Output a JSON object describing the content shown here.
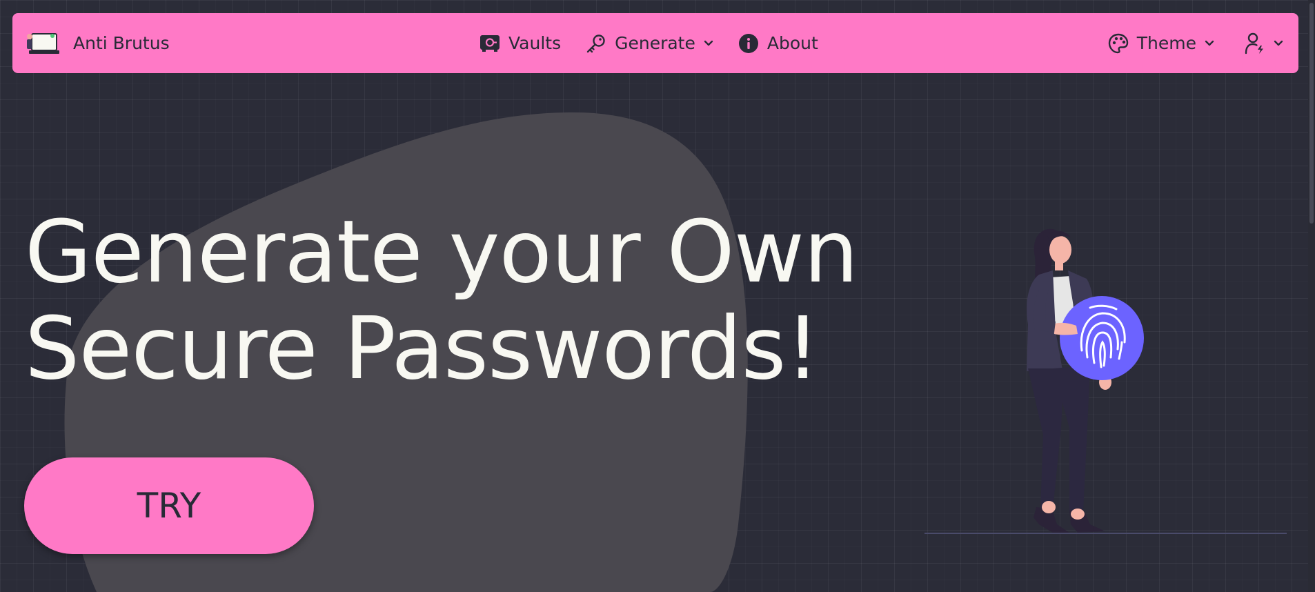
{
  "navbar": {
    "brand_name": "Anti Brutus",
    "brand_logo_icon": "laptop-person-icon",
    "items": [
      {
        "label": "Vaults",
        "icon": "safe-icon"
      },
      {
        "label": "Generate",
        "icon": "key-icon",
        "dropdown": true
      },
      {
        "label": "About",
        "icon": "info-circle-icon"
      }
    ],
    "theme_label": "Theme",
    "theme_icon": "palette-icon",
    "user_icon": "user-bolt-icon",
    "background_color": "#ff79c6"
  },
  "hero": {
    "headline_line1": "Generate your Own",
    "headline_line2": "Secure Passwords!",
    "try_label": "TRY",
    "illustration": "woman-holding-fingerprint-icon"
  },
  "colors": {
    "page_background": "#2b2c38",
    "accent": "#ff79c6",
    "headline_text": "#f8f8f2",
    "fingerprint_circle": "#6c63ff"
  }
}
